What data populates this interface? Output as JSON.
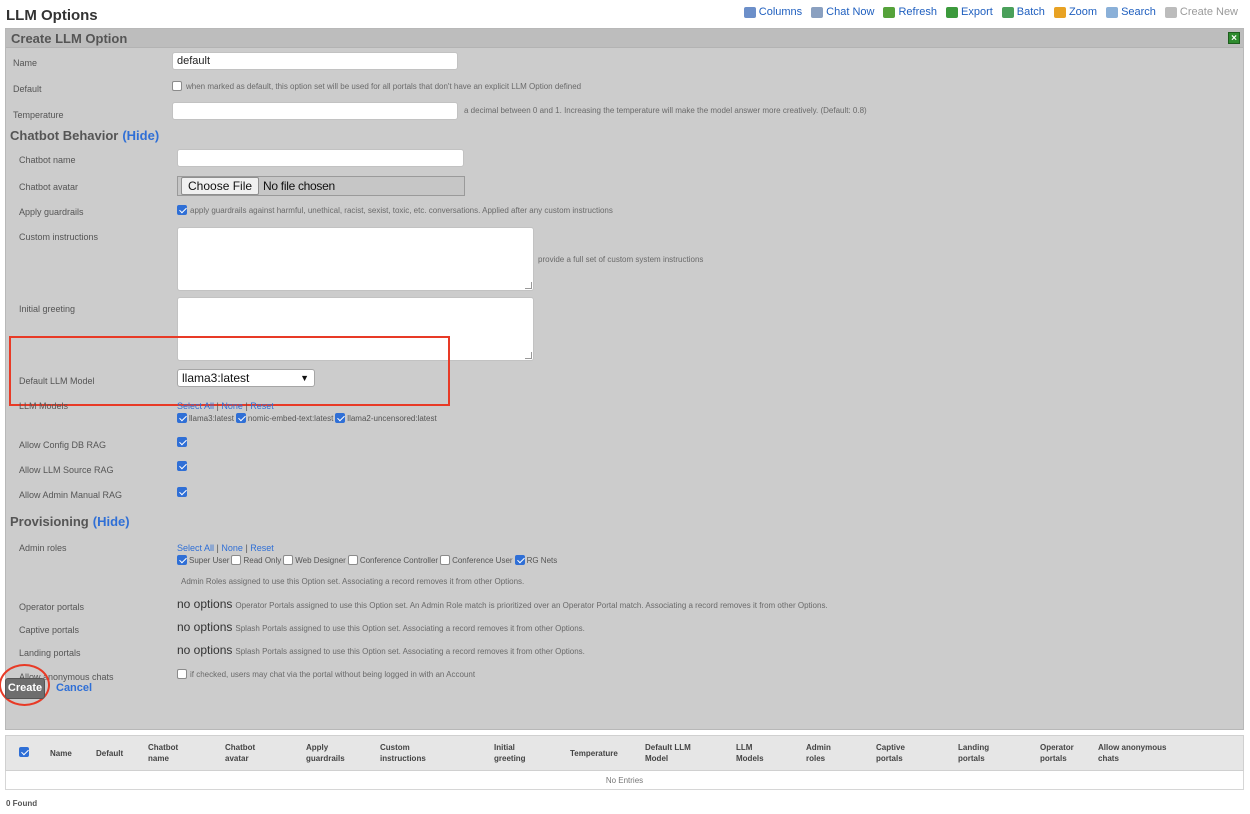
{
  "page": {
    "title": "LLM Options"
  },
  "toolbar": [
    {
      "label": "Columns",
      "icon": "columns-icon",
      "color": "#6c8fc9"
    },
    {
      "label": "Chat Now",
      "icon": "chat-icon",
      "color": "#8aa0c0"
    },
    {
      "label": "Refresh",
      "icon": "refresh-icon",
      "color": "#55a23a"
    },
    {
      "label": "Export",
      "icon": "export-icon",
      "color": "#3c9a3c"
    },
    {
      "label": "Batch",
      "icon": "batch-icon",
      "color": "#4aa05a"
    },
    {
      "label": "Zoom",
      "icon": "zoom-icon",
      "color": "#e8a223"
    },
    {
      "label": "Search",
      "icon": "search-icon",
      "color": "#8ab0d8"
    },
    {
      "label": "Create New",
      "icon": "create-new-icon",
      "color": "#bcbcbc"
    }
  ],
  "form": {
    "title": "Create LLM Option",
    "name": {
      "label": "Name",
      "value": "default"
    },
    "default": {
      "label": "Default",
      "checked": false,
      "hint": "when marked as default, this option set will be used for all portals that don't have an explicit LLM Option defined"
    },
    "temperature": {
      "label": "Temperature",
      "value": "",
      "hint": "a decimal between 0 and 1. Increasing the temperature will make the model answer more creatively. (Default: 0.8)"
    }
  },
  "chatbot": {
    "section_title": "Chatbot Behavior",
    "hide_label": "(Hide)",
    "name_label": "Chatbot name",
    "avatar_label": "Chatbot avatar",
    "choose_file": "Choose File",
    "no_file": "No file chosen",
    "guardrails_label": "Apply guardrails",
    "guardrails_hint": "apply guardrails against harmful, unethical, racist, sexist, toxic, etc. conversations. Applied after any custom instructions",
    "custom_label": "Custom instructions",
    "custom_hint": "provide a full set of custom system instructions",
    "greeting_label": "Initial greeting",
    "default_model_label": "Default LLM Model",
    "default_model_value": "llama3:latest",
    "models_label": "LLM Models",
    "select_all": "Select All",
    "none": "None",
    "reset": "Reset",
    "models": [
      "llama3:latest",
      "nomic-embed-text:latest",
      "llama2-uncensored:latest"
    ],
    "config_rag_label": "Allow Config DB RAG",
    "source_rag_label": "Allow LLM Source RAG",
    "manual_rag_label": "Allow Admin Manual RAG"
  },
  "provisioning": {
    "section_title": "Provisioning",
    "hide_label": "(Hide)",
    "admin_roles_label": "Admin roles",
    "select_all": "Select All",
    "none": "None",
    "reset": "Reset",
    "roles": [
      {
        "label": "Super User",
        "checked": true
      },
      {
        "label": "Read Only",
        "checked": false
      },
      {
        "label": "Web Designer",
        "checked": false
      },
      {
        "label": "Conference Controller",
        "checked": false
      },
      {
        "label": "Conference User",
        "checked": false
      },
      {
        "label": "RG Nets",
        "checked": true
      }
    ],
    "roles_hint": "Admin Roles assigned to use this Option set. Associating a record removes it from other Options.",
    "no_options": "no options",
    "operator_label": "Operator portals",
    "operator_hint": "Operator Portals assigned to use this Option set. An Admin Role match is prioritized over an Operator Portal match. Associating a record removes it from other Options.",
    "captive_label": "Captive portals",
    "captive_hint": "Splash Portals assigned to use this Option set. Associating a record removes it from other Options.",
    "landing_label": "Landing portals",
    "landing_hint": "Splash Portals assigned to use this Option set. Associating a record removes it from other Options.",
    "anon_label": "Allow anonymous chats",
    "anon_hint": "if checked, users may chat via the portal without being logged in with an Account"
  },
  "actions": {
    "create": "Create",
    "cancel": "Cancel"
  },
  "table": {
    "columns": [
      [
        "Name"
      ],
      [
        "Default"
      ],
      [
        "Chatbot",
        "name"
      ],
      [
        "Chatbot",
        "avatar"
      ],
      [
        "Apply",
        "guardrails"
      ],
      [
        "Custom",
        "instructions"
      ],
      [
        "Initial",
        "greeting"
      ],
      [
        "Temperature"
      ],
      [
        "Default LLM",
        "Model"
      ],
      [
        "LLM",
        "Models"
      ],
      [
        "Admin",
        "roles"
      ],
      [
        "Captive",
        "portals"
      ],
      [
        "Landing",
        "portals"
      ],
      [
        "Operator",
        "portals"
      ],
      [
        "Allow anonymous",
        "chats"
      ]
    ],
    "empty": "No Entries",
    "found": "0 Found"
  },
  "colors": {
    "accent": "#2f6fd6",
    "highlight": "#e83a26",
    "panel": "#cccccc"
  }
}
